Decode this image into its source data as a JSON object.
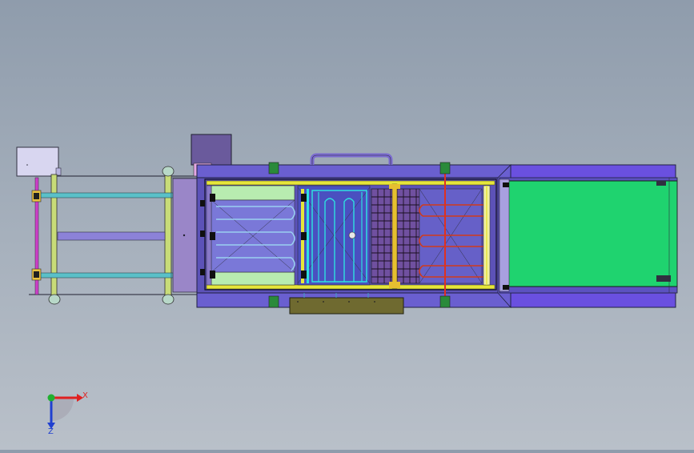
{
  "viewport": {
    "background_top": "#8f9cac",
    "background_bottom": "#b9c0c9"
  },
  "model": {
    "parts": [
      "control-box",
      "motor-box",
      "conveyor-frame",
      "cleaning-section",
      "washing-section",
      "ozone-chamber",
      "drying-section",
      "output-conveyor",
      "handle",
      "drain-tray"
    ],
    "colors": {
      "output_belt": "#1fd36f",
      "chassis": "#6a5fd0",
      "rail_yellow": "#e6e63a",
      "rail_cyan": "#2ee0e0",
      "heater_red": "#d03a1a",
      "tray": "#6f6a30",
      "frame_purple": "#9a86c8"
    }
  },
  "triad": {
    "x_label": "X",
    "z_label": "Z",
    "x_color": "#e02020",
    "y_color": "#20b030",
    "z_color": "#2040d0"
  }
}
